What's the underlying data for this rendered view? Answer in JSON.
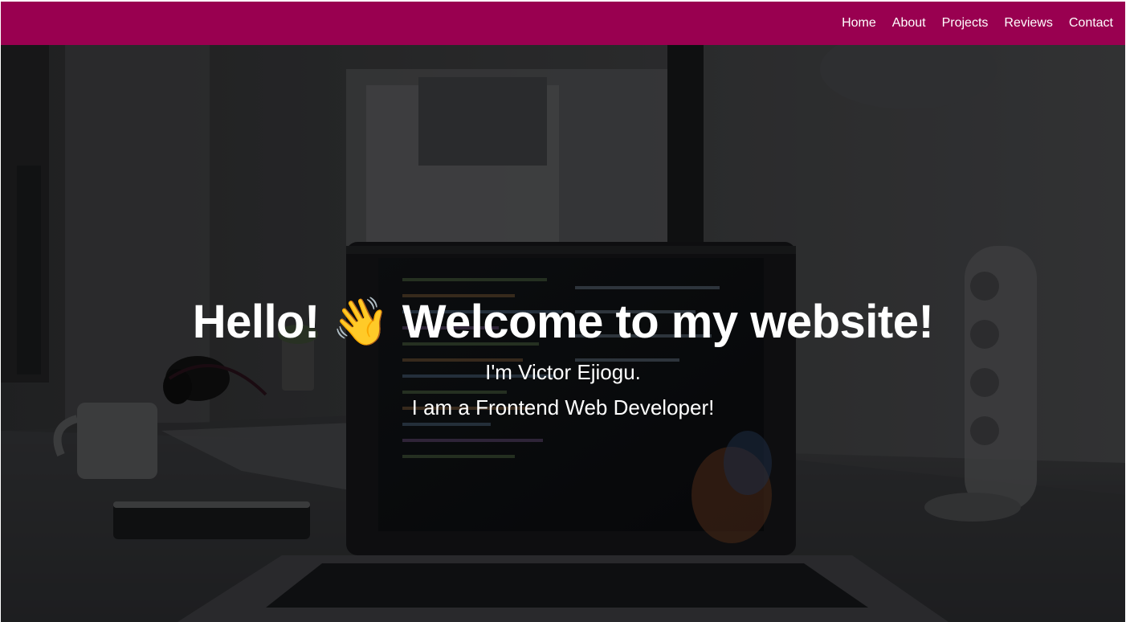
{
  "nav": {
    "items": [
      {
        "label": "Home"
      },
      {
        "label": "About"
      },
      {
        "label": "Projects"
      },
      {
        "label": "Reviews"
      },
      {
        "label": "Contact"
      }
    ]
  },
  "hero": {
    "title": "Hello! 👋 Welcome to my website!",
    "line1": "I'm Victor Ejiogu.",
    "line2": "I am a Frontend Web Developer!",
    "background_image": "laptop-on-desk-photo"
  },
  "colors": {
    "navbar_bg": "#990050",
    "text": "#ffffff",
    "overlay": "rgba(0,0,0,0.45)"
  }
}
